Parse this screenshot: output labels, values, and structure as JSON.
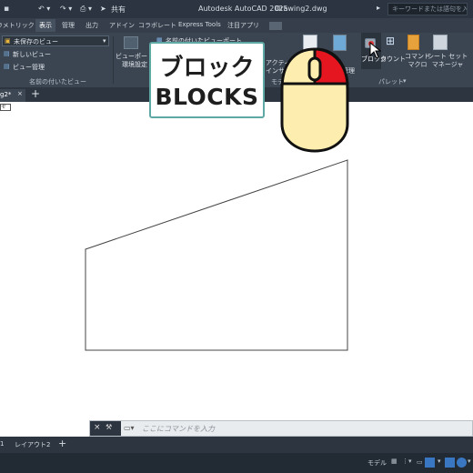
{
  "titlebar": {
    "left_text": "ラメトリック",
    "tab_display": "表示",
    "share": "共有",
    "app_title": "Autodesk AutoCAD 2025",
    "doc_title": "Drawing2.dwg",
    "search_placeholder": "キーワードまたは語句を入力"
  },
  "ribbon_tabs": [
    "ラメトリック",
    "表示",
    "管理",
    "出力",
    "アドイン",
    "コラボレート",
    "Express Tools",
    "注目アプリ"
  ],
  "ribbon": {
    "views_dropdown": "未保存のビュー",
    "new_view": "新しいビュー",
    "view_manager": "ビュー管理",
    "named_views_panel": "名前の付いたビュー",
    "viewport_env": "ビューポート\n環境設定",
    "named_viewport": "名前の付いたビューポート",
    "active": "アクティビ",
    "insights": "インサイ",
    "model_space": "モデル空間",
    "manage": "管理",
    "block": "ブロック",
    "count": "カウント",
    "command_macro": "コマンド\nマクロ",
    "sheet_set_manager": "シート セット\nマネージャ",
    "palette_panel": "パレット"
  },
  "doc_tabs": {
    "drawing_tab": "g2*",
    "add_tab": "+"
  },
  "overlay": {
    "japanese": "ブロック",
    "english": "BLOCKS"
  },
  "command": {
    "placeholder": "ここにコマンドを入力"
  },
  "layout_tabs": [
    "1",
    "レイアウト2",
    "+"
  ],
  "status": {
    "model": "モデル"
  },
  "colors": {
    "mouse_body": "#fdeeb0",
    "mouse_button": "#e5161f",
    "overlay_border": "#5fa9a5"
  }
}
